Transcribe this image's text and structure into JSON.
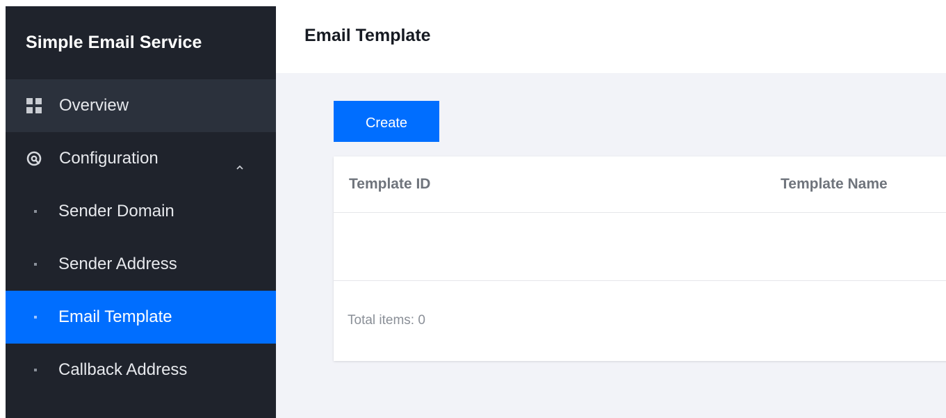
{
  "sidebar": {
    "title": "Simple Email Service",
    "overview": {
      "label": "Overview",
      "icon": "grid-icon"
    },
    "configuration": {
      "label": "Configuration",
      "icon": "config-icon",
      "expanded": true
    },
    "sub_items": [
      {
        "label": "Sender Domain",
        "active": false
      },
      {
        "label": "Sender Address",
        "active": false
      },
      {
        "label": "Email Template",
        "active": true
      },
      {
        "label": "Callback Address",
        "active": false
      }
    ]
  },
  "header": {
    "title": "Email Template"
  },
  "main": {
    "create_label": "Create",
    "table": {
      "columns": [
        "Template ID",
        "Template Name"
      ],
      "rows": [],
      "total_label": "Total items:",
      "total_count": "0"
    }
  },
  "colors": {
    "sidebar_bg": "#1f232c",
    "active_bg": "#006eff",
    "primary": "#006eff",
    "main_bg": "#f2f3f8"
  }
}
